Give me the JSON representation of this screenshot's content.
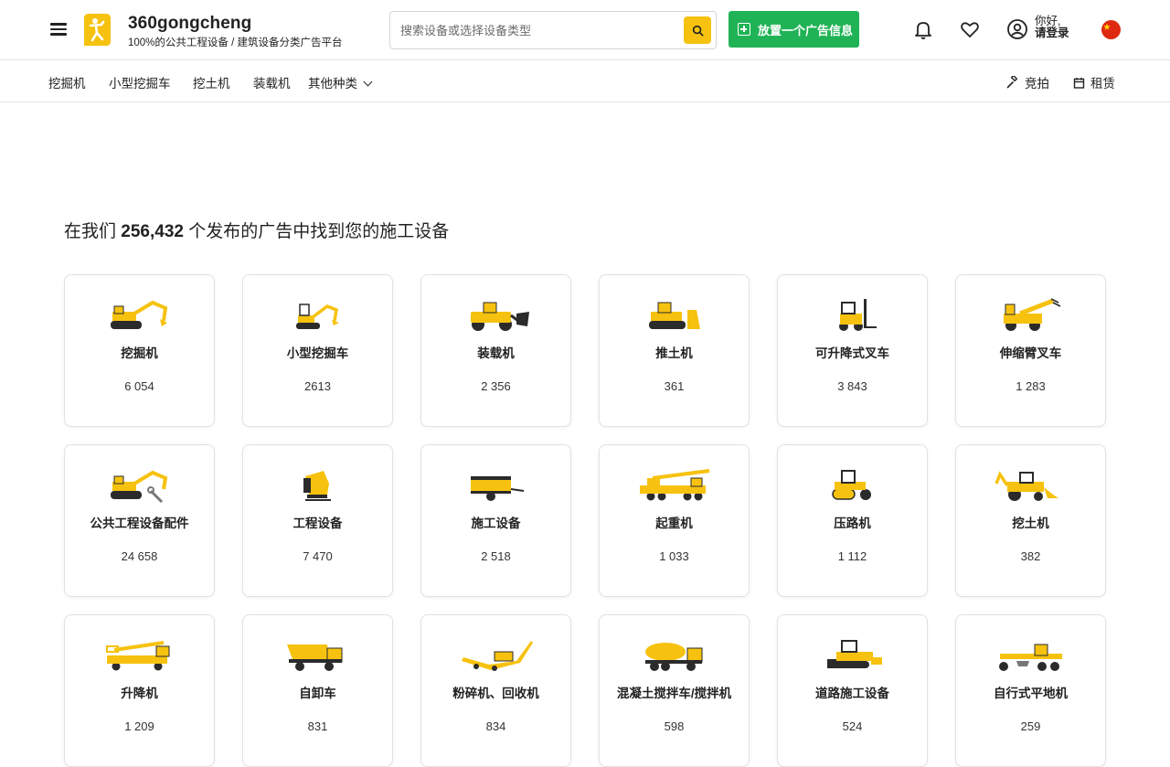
{
  "header": {
    "brand_name": "360gongcheng",
    "brand_tagline": "100%的公共工程设备 / 建筑设备分类广告平台",
    "search_placeholder": "搜索设备或选择设备类型",
    "post_ad_label": "放置一个广告信息",
    "greeting_line1": "你好,",
    "greeting_line2": "请登录",
    "accent_color": "#f6c20f",
    "post_button_color": "#20b356",
    "icons": [
      "menu-icon",
      "logo-icon",
      "search-icon",
      "plus-icon",
      "bell-icon",
      "heart-icon",
      "user-icon",
      "china-flag-icon"
    ]
  },
  "subnav": {
    "items": [
      "挖掘机",
      "小型挖掘车",
      "挖土机",
      "装载机",
      "其他种类"
    ],
    "right_items": [
      {
        "label": "竞拍",
        "icon": "gavel-icon"
      },
      {
        "label": "租赁",
        "icon": "calendar-icon"
      }
    ]
  },
  "main": {
    "headline_prefix": "在我们",
    "headline_count": "256,432",
    "headline_suffix": "个发布的广告中找到您的施工设备"
  },
  "categories": [
    {
      "name": "挖掘机",
      "count": "6 054",
      "icon": "excavator-icon"
    },
    {
      "name": "小型挖掘车",
      "count": "2613",
      "icon": "mini-excavator-icon"
    },
    {
      "name": "装载机",
      "count": "2 356",
      "icon": "wheel-loader-icon"
    },
    {
      "name": "推土机",
      "count": "361",
      "icon": "bulldozer-icon"
    },
    {
      "name": "可升降式叉车",
      "count": "3 843",
      "icon": "forklift-icon"
    },
    {
      "name": "伸缩臂叉车",
      "count": "1 283",
      "icon": "telehandler-icon"
    },
    {
      "name": "公共工程设备配件",
      "count": "24 658",
      "icon": "excavator-parts-icon"
    },
    {
      "name": "工程设备",
      "count": "7 470",
      "icon": "bucket-attachment-icon"
    },
    {
      "name": "施工设备",
      "count": "2 518",
      "icon": "compressor-trailer-icon"
    },
    {
      "name": "起重机",
      "count": "1 033",
      "icon": "crane-truck-icon"
    },
    {
      "name": "压路机",
      "count": "1 112",
      "icon": "road-roller-icon"
    },
    {
      "name": "挖土机",
      "count": "382",
      "icon": "backhoe-loader-icon"
    },
    {
      "name": "升降机",
      "count": "1 209",
      "icon": "aerial-lift-truck-icon"
    },
    {
      "name": "自卸车",
      "count": "831",
      "icon": "dump-truck-icon"
    },
    {
      "name": "粉碎机、回收机",
      "count": "834",
      "icon": "crusher-icon"
    },
    {
      "name": "混凝土搅拌车/搅拌机",
      "count": "598",
      "icon": "concrete-mixer-icon"
    },
    {
      "name": "道路施工设备",
      "count": "524",
      "icon": "asphalt-paver-icon"
    },
    {
      "name": "自行式平地机",
      "count": "259",
      "icon": "motor-grader-icon"
    }
  ]
}
